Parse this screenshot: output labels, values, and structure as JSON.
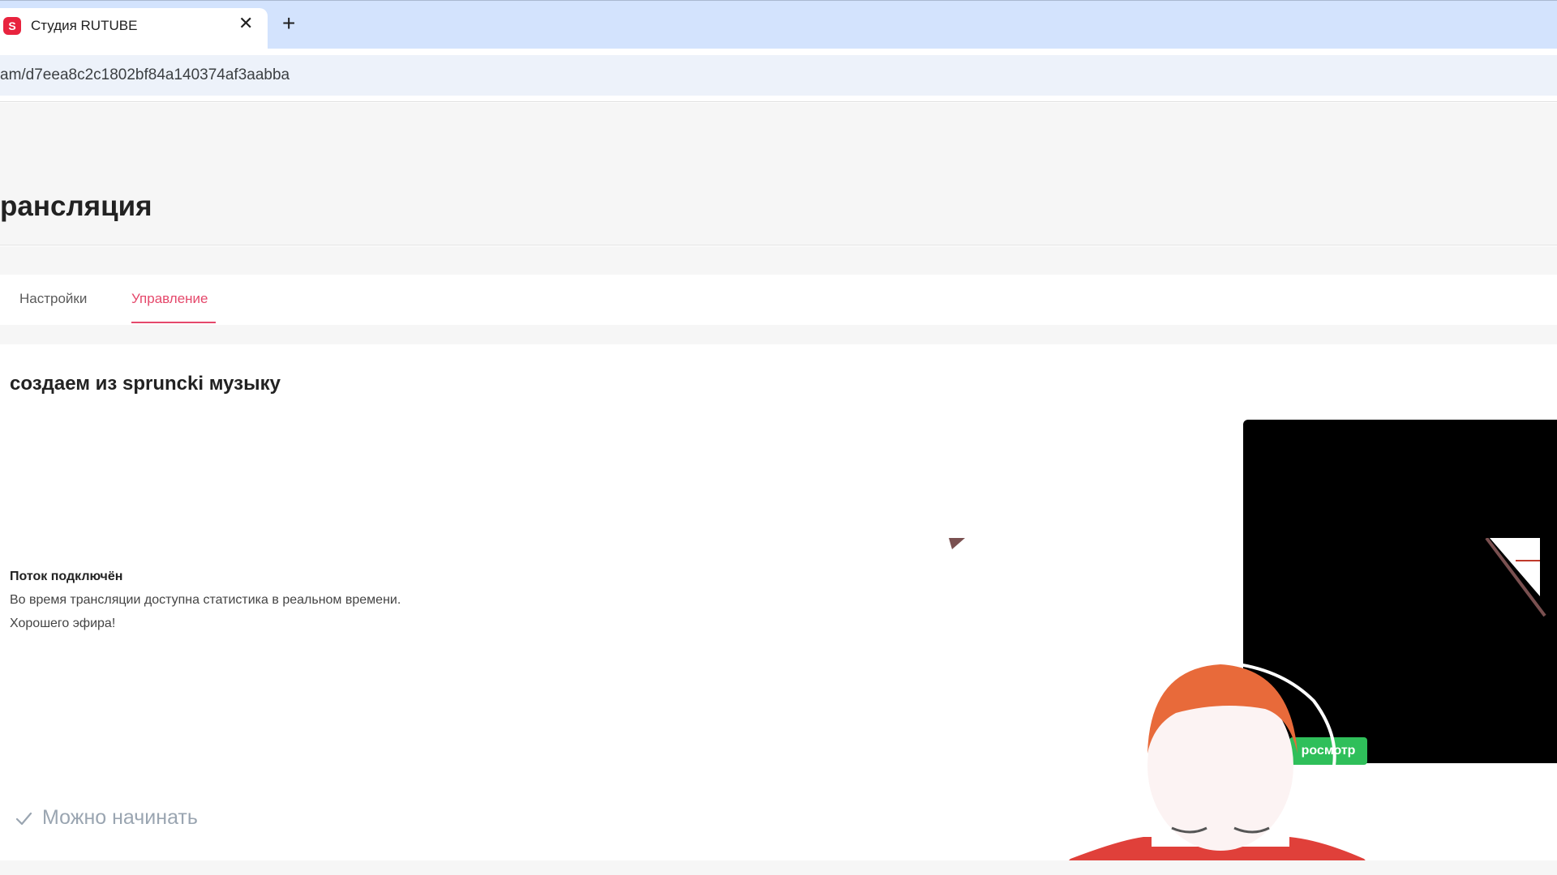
{
  "browser": {
    "tab_title": "Студия RUTUBE",
    "tab_close": "✕",
    "new_tab": "+",
    "url": "am/d7eea8c2c1802bf84a140374af3aabba",
    "favicon_letter": "S"
  },
  "page": {
    "title": "рансляция"
  },
  "tabs": [
    {
      "label": "Настройки",
      "active": false
    },
    {
      "label": "Управление",
      "active": true
    }
  ],
  "stream": {
    "title": "создаем из sprunckі музыку",
    "status_heading": "Поток подключён",
    "status_line_1": "Во время трансляции доступна статистика в реальном времени.",
    "status_line_2": "Хорошего эфира!",
    "ready_label": "Можно начинать"
  },
  "preview": {
    "badge_label": "росмотр"
  },
  "colors": {
    "accent": "#e5486b",
    "brand": "#e8233e",
    "badge": "#2fbf5a",
    "muted": "#9aa5b1"
  },
  "icons": {
    "favicon": "rutube-studio-icon",
    "close": "close-icon",
    "new_tab": "plus-icon",
    "ready": "check-icon"
  }
}
